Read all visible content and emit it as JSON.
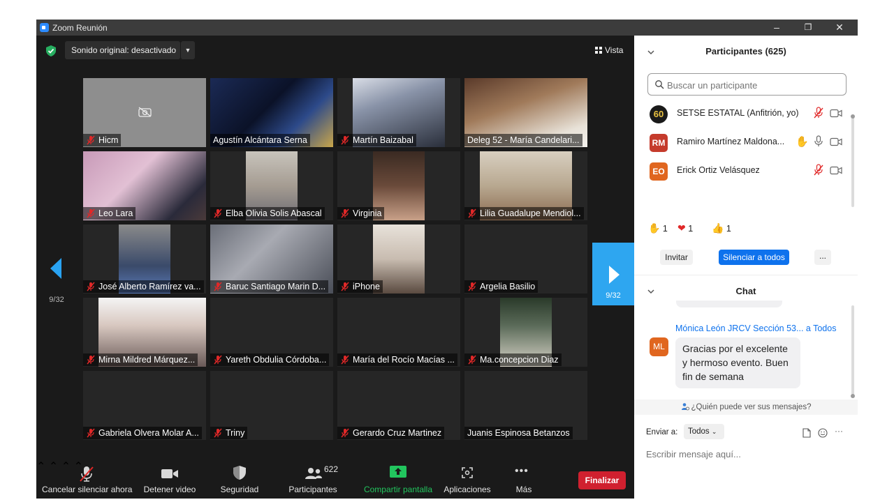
{
  "window": {
    "title": "Zoom Reunión"
  },
  "top_bar": {
    "original_sound": "Sonido original: desactivado",
    "view": "Vista"
  },
  "pagination": {
    "prev": "9/32",
    "next": "9/32"
  },
  "tiles": [
    {
      "name": "Hicm",
      "muted": true,
      "video": "off"
    },
    {
      "name": "Agustín Alcántara Serna",
      "muted": false,
      "video": "on"
    },
    {
      "name": "Martín Baizabal",
      "muted": true,
      "video": "on"
    },
    {
      "name": "Deleg 52 - María Candelari...",
      "muted": false,
      "video": "on"
    },
    {
      "name": "Leo Lara",
      "muted": true,
      "video": "on"
    },
    {
      "name": "Elba Olivia Solis Abascal",
      "muted": true,
      "video": "on"
    },
    {
      "name": "Virginia",
      "muted": true,
      "video": "on"
    },
    {
      "name": "Lilia Guadalupe Mendiol...",
      "muted": true,
      "video": "on"
    },
    {
      "name": "José Alberto Ramírez va...",
      "muted": true,
      "video": "on"
    },
    {
      "name": "Baruc Santiago Marin D...",
      "muted": true,
      "video": "on"
    },
    {
      "name": "iPhone",
      "muted": true,
      "video": "on"
    },
    {
      "name": "Argelia Basilio",
      "muted": true,
      "video": "off"
    },
    {
      "name": "Mirna Mildred Márquez...",
      "muted": true,
      "video": "on"
    },
    {
      "name": "Yareth Obdulia Córdoba...",
      "muted": true,
      "video": "off"
    },
    {
      "name": "María del Rocío Macías ...",
      "muted": true,
      "video": "off"
    },
    {
      "name": "Ma.concepcion  Diaz",
      "muted": true,
      "video": "on"
    },
    {
      "name": "Gabriela Olvera Molar A...",
      "muted": true,
      "video": "off"
    },
    {
      "name": "Triny",
      "muted": true,
      "video": "off"
    },
    {
      "name": "Gerardo Cruz Martinez",
      "muted": true,
      "video": "off"
    },
    {
      "name": "Juanis Espinosa Betanzos",
      "muted": false,
      "video": "off"
    }
  ],
  "toolbar": {
    "unmute": "Cancelar silenciar ahora",
    "stop_video": "Detener video",
    "security": "Seguridad",
    "participants": "Participantes",
    "participants_count": "622",
    "share": "Compartir pantalla",
    "apps": "Aplicaciones",
    "more": "Más",
    "end": "Finalizar"
  },
  "participants_panel": {
    "title": "Participantes (625)",
    "search_placeholder": "Buscar un participante",
    "list": [
      {
        "name": "SETSE ESTATAL (Anfitrión, yo)",
        "avatar": "60",
        "avatar_color": "#1a1a1a",
        "mic": "muted",
        "hand": false
      },
      {
        "name": "Ramiro Martínez Maldona...",
        "avatar": "RM",
        "avatar_color": "#c53b2c",
        "mic": "on",
        "hand": true
      },
      {
        "name": "Erick Ortiz Velásquez",
        "avatar": "EO",
        "avatar_color": "#e0661f",
        "mic": "muted",
        "hand": false
      }
    ],
    "reactions": [
      {
        "emoji": "✋",
        "count": "1"
      },
      {
        "emoji": "❤",
        "count": "1"
      },
      {
        "emoji": "👍",
        "count": "1"
      }
    ],
    "invite": "Invitar",
    "mute_all": "Silenciar a todos",
    "more": "..."
  },
  "chat": {
    "title": "Chat",
    "message": {
      "sender": "Mónica León JRCV Sección 53...",
      "to": " a Todos",
      "avatar": "ML",
      "text": "Gracias por el excelente y hermoso evento. Buen fin de semana"
    },
    "who_can_see": "¿Quién puede ver sus mensajes?",
    "send_to_label": "Enviar a:",
    "send_to_value": "Todos",
    "input_placeholder": "Escribir mensaje aquí..."
  },
  "colors": {
    "accent": "#0e72ed",
    "end": "#d0202f",
    "share": "#22c55e",
    "muted": "#e02828",
    "page_arrow": "#2ea6f0"
  }
}
